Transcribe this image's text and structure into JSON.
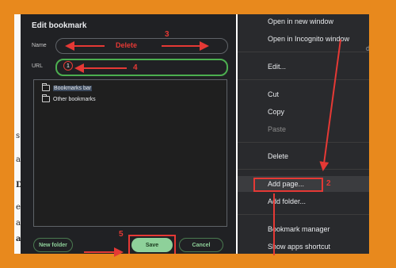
{
  "background_page": {
    "letters": [
      "s",
      "a",
      "D",
      "e",
      "a",
      "as"
    ]
  },
  "dialog": {
    "title": "Edit bookmark",
    "name_label": "Name",
    "name_value": "",
    "url_label": "URL",
    "url_value": "",
    "folders": [
      {
        "label": "Bookmarks bar",
        "selected": true,
        "icon": "folder-icon"
      },
      {
        "label": "Other bookmarks",
        "selected": false,
        "icon": "folder-icon"
      }
    ],
    "buttons": {
      "new_folder": "New folder",
      "save": "Save",
      "cancel": "Cancel"
    }
  },
  "context_menu": {
    "items": [
      {
        "label": "Open in new window",
        "disabled": false
      },
      {
        "label": "Open in Incognito window",
        "disabled": false
      },
      {
        "label": "Edit...",
        "disabled": false
      },
      {
        "label": "Cut",
        "disabled": false
      },
      {
        "label": "Copy",
        "disabled": false
      },
      {
        "label": "Paste",
        "disabled": true
      },
      {
        "label": "Delete",
        "disabled": false
      },
      {
        "label": "Add page...",
        "disabled": false,
        "highlighted": true
      },
      {
        "label": "Add folder...",
        "disabled": false
      },
      {
        "label": "Bookmark manager",
        "disabled": false
      },
      {
        "label": "Show apps shortcut",
        "disabled": false
      }
    ],
    "peek_text": "di"
  },
  "annotations": {
    "step_labels": [
      "1",
      "2",
      "3",
      "4",
      "5"
    ],
    "delete_text": "Delete",
    "color": "#e53935"
  },
  "colors": {
    "frame": "#e8891d",
    "dialog_bg": "#202124",
    "menu_bg": "#292a2d",
    "accent_green": "#8ed19a"
  }
}
